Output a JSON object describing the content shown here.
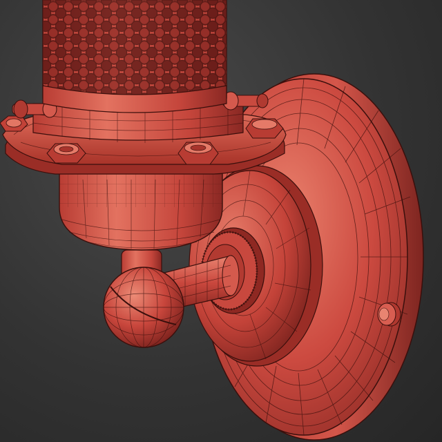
{
  "render": {
    "subject": "wall-sconce-lamp",
    "style": "wireframe-over-shaded",
    "colors": {
      "background": "#2f2f2f",
      "base_red": "#c9463e",
      "light_red": "#e0705f",
      "dark_red": "#8a2621",
      "wire": "#3a0f0c"
    }
  }
}
